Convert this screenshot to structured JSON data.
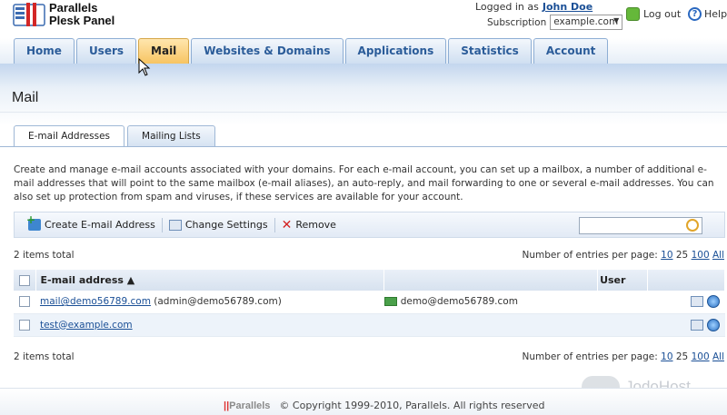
{
  "header": {
    "brand_line1": "Parallels",
    "brand_line2": "Plesk Panel",
    "logged_in_label": "Logged in as",
    "user_name": "John Doe",
    "subscription_label": "Subscription",
    "subscription_value": "example.com",
    "logout_label": "Log out",
    "help_label": "Help"
  },
  "tabs": [
    {
      "label": "Home",
      "active": false
    },
    {
      "label": "Users",
      "active": false
    },
    {
      "label": "Mail",
      "active": true
    },
    {
      "label": "Websites & Domains",
      "active": false
    },
    {
      "label": "Applications",
      "active": false
    },
    {
      "label": "Statistics",
      "active": false
    },
    {
      "label": "Account",
      "active": false
    }
  ],
  "page_title": "Mail",
  "subtabs": [
    {
      "label": "E-mail Addresses",
      "active": true
    },
    {
      "label": "Mailing Lists",
      "active": false
    }
  ],
  "description": "Create and manage e-mail accounts associated with your domains. For each e-mail account, you can set up a mailbox, a number of additional e-mail addresses that will point to the same mailbox (e-mail aliases), an auto-reply, and mail forwarding to one or several e-mail addresses. You can also set up protection from spam and viruses, if these services are available for your account.",
  "toolbar": {
    "create_label": "Create E-mail Address",
    "settings_label": "Change Settings",
    "remove_label": "Remove",
    "search_value": ""
  },
  "list": {
    "total_label": "2 items total",
    "per_page_label": "Number of entries per page:",
    "per_page_options": [
      "10",
      "25",
      "100",
      "All"
    ],
    "per_page_current": "25",
    "columns": {
      "email": "E-mail address ▲",
      "user": "User"
    },
    "rows": [
      {
        "email": "mail@demo56789.com",
        "note": "(admin@demo56789.com)",
        "forward": "demo@demo56789.com",
        "user": ""
      },
      {
        "email": "test@example.com",
        "note": "",
        "forward": "",
        "user": ""
      }
    ]
  },
  "footer": {
    "logo_text": "Parallels",
    "copyright": "© Copyright 1999-2010, Parallels. All rights reserved"
  },
  "watermark": "JodoHost"
}
